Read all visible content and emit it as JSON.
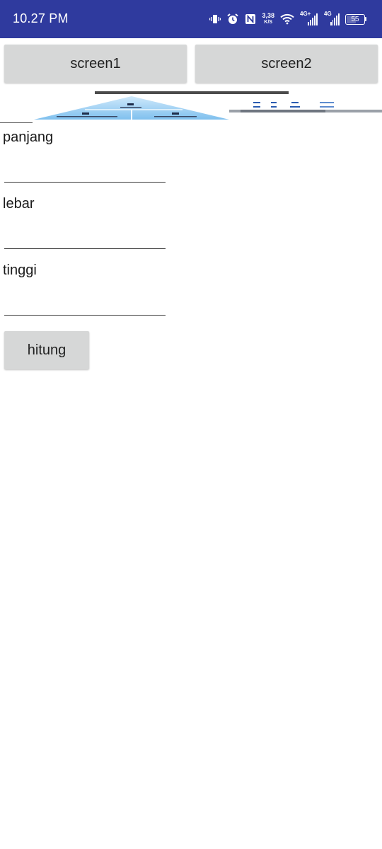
{
  "status_bar": {
    "time": "10.27 PM",
    "net_speed_value": "3,38",
    "net_speed_unit": "K/S",
    "sim1_label": "4G+",
    "sim2_label": "4G",
    "battery_level": "55",
    "icons": [
      "vibrate-icon",
      "alarm-icon",
      "nfc-icon",
      "net-speed",
      "wifi-icon",
      "signal-icon",
      "signal-icon",
      "battery-icon"
    ],
    "background": "#2f3a9e"
  },
  "nav": {
    "screen1_label": "screen1",
    "screen2_label": "screen2"
  },
  "form": {
    "panjang_label": "panjang",
    "lebar_label": "lebar",
    "tinggi_label": "tinggi",
    "panjang_value": "",
    "lebar_value": "",
    "tinggi_value": "",
    "submit_label": "hitung"
  },
  "image": {
    "title_text": "PRESSURE FORMULA",
    "top_symbol": "F",
    "left_symbol": "P",
    "right_symbol": "A"
  },
  "colors": {
    "button_bg": "#d6d7d7",
    "triangle_blue": "#8ec9f2"
  }
}
